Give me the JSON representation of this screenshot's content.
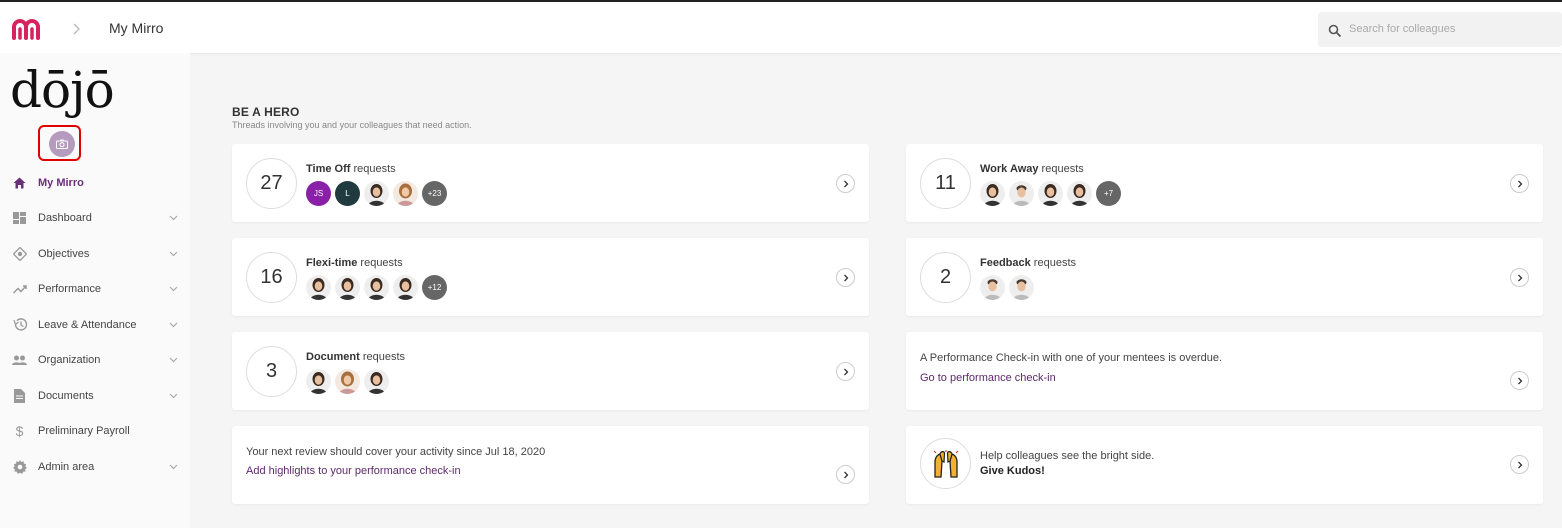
{
  "topbar": {
    "breadcrumb_title": "My Mirro",
    "search_placeholder": "Search for colleagues"
  },
  "sidebar": {
    "brand": "dōjō",
    "nav": [
      {
        "label": "My Mirro",
        "icon": "home-icon",
        "active": true
      },
      {
        "label": "Dashboard",
        "icon": "dashboard-icon"
      },
      {
        "label": "Objectives",
        "icon": "objectives-icon"
      },
      {
        "label": "Performance",
        "icon": "trending-icon"
      },
      {
        "label": "Leave & Attendance",
        "icon": "history-icon"
      },
      {
        "label": "Organization",
        "icon": "people-icon"
      },
      {
        "label": "Documents",
        "icon": "document-icon"
      },
      {
        "label": "Preliminary Payroll",
        "icon": "dollar-icon"
      },
      {
        "label": "Admin area",
        "icon": "gear-icon"
      }
    ]
  },
  "hero": {
    "title": "BE A HERO",
    "subtitle": "Threads involving you and your colleagues that need action."
  },
  "cards": {
    "time_off": {
      "count": "27",
      "title_bold": "Time Off",
      "title_rest": " requests",
      "more": "+23",
      "initials": [
        "JS",
        "L"
      ]
    },
    "work_away": {
      "count": "11",
      "title_bold": "Work Away",
      "title_rest": " requests",
      "more": "+7"
    },
    "flexi": {
      "count": "16",
      "title_bold": "Flexi-time",
      "title_rest": " requests",
      "more": "+12"
    },
    "feedback": {
      "count": "2",
      "title_bold": "Feedback",
      "title_rest": " requests"
    },
    "document": {
      "count": "3",
      "title_bold": "Document",
      "title_rest": " requests"
    },
    "checkin": {
      "text": "A Performance Check-in with one of your mentees is overdue.",
      "link": "Go to performance check-in"
    },
    "review": {
      "text": "Your next review should cover your activity since Jul 18, 2020",
      "link": "Add highlights to your performance check-in"
    },
    "kudos": {
      "text": "Help colleagues see the bright side.",
      "link": "Give Kudos!"
    }
  },
  "colors": {
    "brand_pink": "#d6245f",
    "active_purple": "#6b2f7a",
    "avatar_purple": "#8a1fa8",
    "avatar_dark_teal": "#1f3b3f",
    "more_gray": "#666666"
  }
}
